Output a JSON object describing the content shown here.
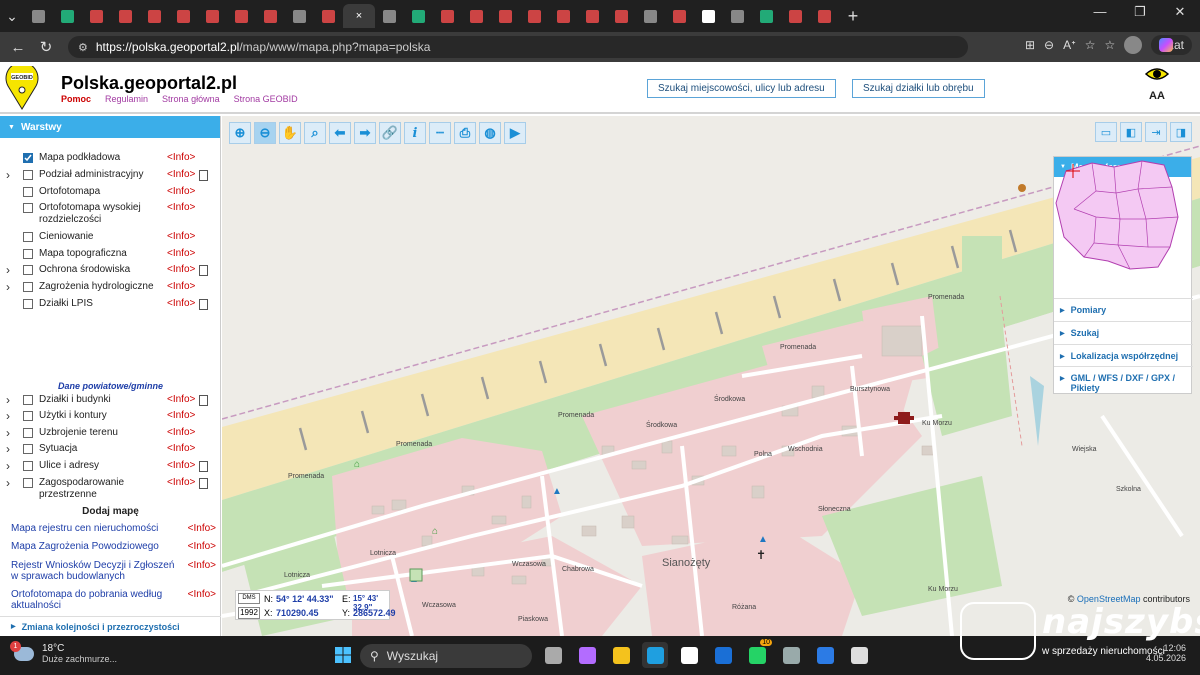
{
  "browser": {
    "tabs_count": 28,
    "active_tab_close": "×",
    "new_tab": "+",
    "url_host": "https://polska.geoportal2.pl",
    "url_path": "/map/www/mapa.php?mapa=polska",
    "copilot_label": "Czat"
  },
  "header": {
    "logo_text": "GEOBID",
    "title": "Polska.geoportal2.pl",
    "links": {
      "help": "Pomoc",
      "rules": "Regulamin",
      "home": "Strona główna",
      "geobid": "Strona GEOBID"
    },
    "search_place": "Szukaj miejscowości, ulicy lub adresu",
    "search_parcel": "Szukaj działki lub obrębu",
    "aa_label": "AA"
  },
  "sidebar": {
    "title": "Warstwy",
    "layers": [
      {
        "name": "Mapa podkładowa",
        "info": "<Info>",
        "checked": true,
        "expandable": false,
        "doc": false
      },
      {
        "name": "Podział administracyjny",
        "info": "<Info>",
        "checked": false,
        "expandable": true,
        "doc": true
      },
      {
        "name": "Ortofotomapa",
        "info": "<Info>",
        "checked": false,
        "expandable": false,
        "doc": false
      },
      {
        "name": "Ortofotomapa wysokiej rozdzielczości",
        "info": "<Info>",
        "checked": false,
        "expandable": false,
        "doc": false
      },
      {
        "name": "Cieniowanie",
        "info": "<Info>",
        "checked": false,
        "expandable": false,
        "doc": false
      },
      {
        "name": "Mapa topograficzna",
        "info": "<Info>",
        "checked": false,
        "expandable": false,
        "doc": false
      },
      {
        "name": "Ochrona środowiska",
        "info": "<Info>",
        "checked": false,
        "expandable": true,
        "doc": true
      },
      {
        "name": "Zagrożenia hydrologiczne",
        "info": "<Info>",
        "checked": false,
        "expandable": true,
        "doc": false
      },
      {
        "name": "Działki LPIS",
        "info": "<Info>",
        "checked": false,
        "expandable": false,
        "doc": true
      }
    ],
    "subheading": "Dane powiatowe/gminne",
    "local_layers": [
      {
        "name": "Działki i budynki",
        "info": "<Info>",
        "doc": true
      },
      {
        "name": "Użytki i kontury",
        "info": "<Info>",
        "doc": false
      },
      {
        "name": "Uzbrojenie terenu",
        "info": "<Info>",
        "doc": false
      },
      {
        "name": "Sytuacja",
        "info": "<Info>",
        "doc": false
      },
      {
        "name": "Ulice i adresy",
        "info": "<Info>",
        "doc": true
      },
      {
        "name": "Zagospodarowanie przestrzenne",
        "info": "<Info>",
        "doc": true
      }
    ],
    "add_map_title": "Dodaj mapę",
    "add_maps": [
      {
        "name": "Mapa rejestru cen nieruchomości",
        "info": "<Info>"
      },
      {
        "name": "Mapa Zagrożenia Powodziowego",
        "info": "<Info>"
      },
      {
        "name": "Rejestr Wniosków Decyzji i Zgłoszeń w sprawach budowlanych",
        "info": "<Info>"
      },
      {
        "name": "Ortofotomapa do pobrania według aktualności",
        "info": "<Info>"
      }
    ],
    "footer": "Zmiana kolejności i przezroczystości"
  },
  "toolbar": {
    "tools": [
      "zoom-in",
      "zoom-out",
      "pan",
      "zoom-box",
      "back",
      "forward",
      "link",
      "info",
      "measure",
      "print",
      "globe",
      "camera"
    ],
    "view_tools": [
      "full-view",
      "split-left",
      "export",
      "split-right"
    ]
  },
  "ref_panel": {
    "title": "Mapa referencyjna",
    "items": [
      "Pomiary",
      "Szukaj",
      "Lokalizacja współrzędnej",
      "GML / WFS / DXF / GPX / Pikiety"
    ]
  },
  "coords": {
    "badge": "DMS",
    "system": "1992",
    "n_label": "N:",
    "n_value": "54° 12' 44.33\"",
    "e_label": "E:",
    "e_value": "15° 43' 32.9\"",
    "x_label": "X:",
    "x_value": "710290.45",
    "y_label": "Y:",
    "y_value": "286572.49"
  },
  "map": {
    "attribution_prefix": "© ",
    "attribution_link": "OpenStreetMap",
    "attribution_suffix": " contributors",
    "town": "Sianożęty",
    "streets": [
      "Promenada",
      "Promenada",
      "Promenada",
      "Promenada",
      "Promenada",
      "Środkowa",
      "Środkowa",
      "Wschodnia",
      "Polna",
      "Lotnicza",
      "Lotnicza",
      "Wczasowa",
      "Wczasowa",
      "Chabrowa",
      "Bursztynowa",
      "Różana",
      "Piaskowa",
      "Słoneczna",
      "Ku Morzu",
      "Ku Morzu",
      "Wiejska",
      "Szkolna"
    ]
  },
  "taskbar": {
    "temp": "18°C",
    "weather": "Duże zachmurze...",
    "weather_badge": "1",
    "search": "Wyszukaj",
    "whatsapp_badge": "10",
    "time": "12:06",
    "date": "4.05.2026"
  },
  "watermark": {
    "brand": "najszybsi",
    "slogan": "w sprzedaży nieruchomości"
  }
}
